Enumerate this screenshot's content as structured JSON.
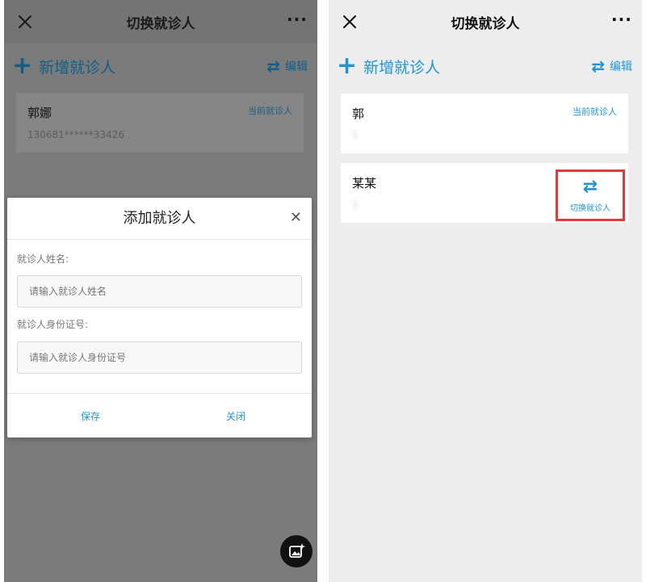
{
  "left": {
    "topbar": {
      "title": "切换就诊人"
    },
    "add_label": "新增就诊人",
    "edit_label": "编辑",
    "patient": {
      "name": "郭娜",
      "id_number": "130681******33426",
      "current_label": "当前就诊人"
    },
    "modal": {
      "title": "添加就诊人",
      "name_label": "就诊人姓名:",
      "name_placeholder": "请输入就诊人姓名",
      "id_label": "就诊人身份证号:",
      "id_placeholder": "请输入就诊人身份证号",
      "save_label": "保存",
      "close_label": "关闭"
    }
  },
  "right": {
    "topbar": {
      "title": "切换就诊人"
    },
    "add_label": "新增就诊人",
    "edit_label": "编辑",
    "patients": [
      {
        "name": "郭",
        "id_number": "1",
        "current_label": "当前就诊人"
      },
      {
        "name": "某某",
        "id_number": "1",
        "switch_label": "切换就诊人"
      }
    ]
  },
  "colors": {
    "accent": "#1e96d4",
    "highlight_border": "#e53935"
  }
}
